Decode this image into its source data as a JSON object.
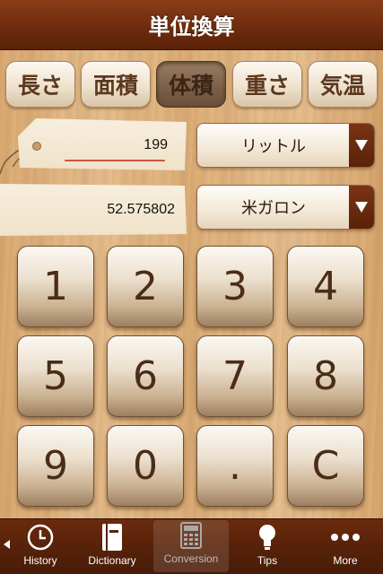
{
  "title": "単位換算",
  "tabs": [
    {
      "label": "長さ",
      "active": false
    },
    {
      "label": "面積",
      "active": false
    },
    {
      "label": "体積",
      "active": true
    },
    {
      "label": "重さ",
      "active": false
    },
    {
      "label": "気温",
      "active": false
    }
  ],
  "input": {
    "value": "199",
    "unit": "リットル"
  },
  "output": {
    "value": "52.575802",
    "unit": "米ガロン"
  },
  "keypad": [
    "1",
    "2",
    "3",
    "4",
    "5",
    "6",
    "7",
    "8",
    "9",
    "0",
    ".",
    "C"
  ],
  "tabbar": [
    {
      "label": "History",
      "icon": "clock-icon"
    },
    {
      "label": "Dictionary",
      "icon": "book-icon"
    },
    {
      "label": "Conversion",
      "icon": "calculator-icon",
      "active": true
    },
    {
      "label": "Tips",
      "icon": "lightbulb-icon"
    },
    {
      "label": "More",
      "icon": "more-dots-icon"
    }
  ],
  "colors": {
    "bar": "#6b2b0c",
    "wood": "#e2b784",
    "key_text": "#4a2d17"
  }
}
